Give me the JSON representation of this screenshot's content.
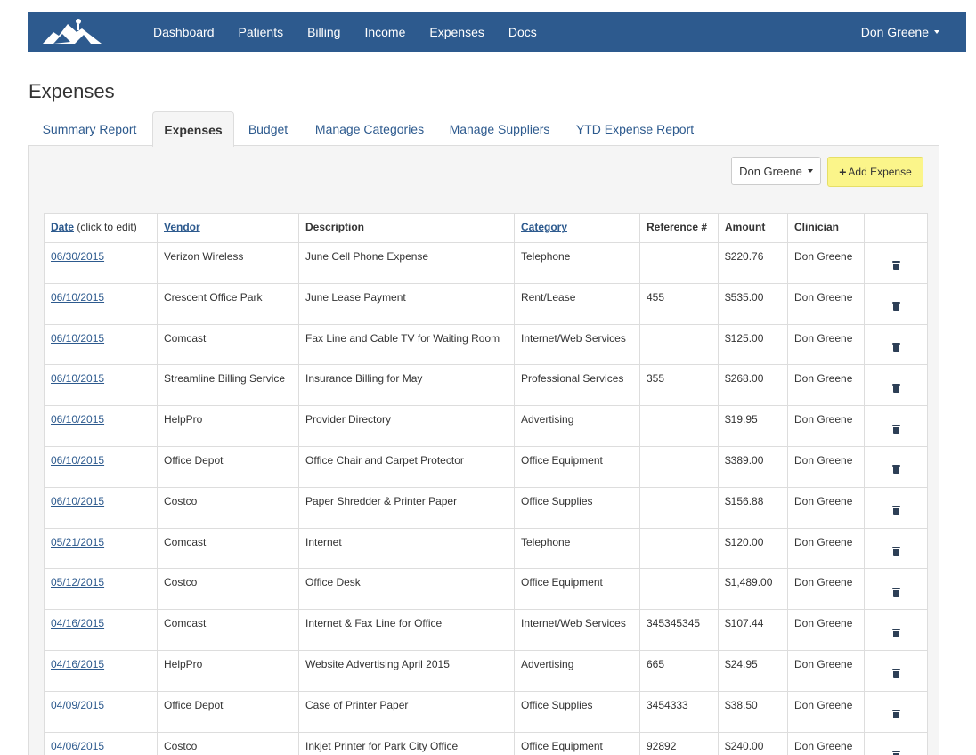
{
  "nav": {
    "links": [
      {
        "name": "nav-dashboard",
        "label": "Dashboard"
      },
      {
        "name": "nav-patients",
        "label": "Patients"
      },
      {
        "name": "nav-billing",
        "label": "Billing"
      },
      {
        "name": "nav-income",
        "label": "Income"
      },
      {
        "name": "nav-expenses",
        "label": "Expenses"
      },
      {
        "name": "nav-docs",
        "label": "Docs"
      }
    ],
    "user": "Don Greene",
    "logo_icon": "mountain-logo-icon"
  },
  "page": {
    "title": "Expenses"
  },
  "tabs": [
    {
      "name": "tab-summary-report",
      "label": "Summary Report",
      "active": false
    },
    {
      "name": "tab-expenses",
      "label": "Expenses",
      "active": true
    },
    {
      "name": "tab-budget",
      "label": "Budget",
      "active": false
    },
    {
      "name": "tab-manage-categories",
      "label": "Manage Categories",
      "active": false
    },
    {
      "name": "tab-manage-suppliers",
      "label": "Manage Suppliers",
      "active": false
    },
    {
      "name": "tab-ytd-expense-report",
      "label": "YTD Expense Report",
      "active": false
    }
  ],
  "toolbar": {
    "clinician_select": "Don Greene",
    "add_label": "Add Expense",
    "add_icon": "plus-icon"
  },
  "table": {
    "headers": {
      "date": "Date",
      "date_hint": "(click to edit)",
      "vendor": "Vendor",
      "description": "Description",
      "category": "Category",
      "reference": "Reference #",
      "amount": "Amount",
      "clinician": "Clinician"
    },
    "delete_icon": "trash-icon",
    "rows": [
      {
        "date": "06/30/2015",
        "vendor": "Verizon Wireless",
        "description": "June Cell Phone Expense",
        "category": "Telephone",
        "reference": "",
        "amount": "$220.76",
        "clinician": "Don Greene"
      },
      {
        "date": "06/10/2015",
        "vendor": "Crescent Office Park",
        "description": "June Lease Payment",
        "category": "Rent/Lease",
        "reference": "455",
        "amount": "$535.00",
        "clinician": "Don Greene"
      },
      {
        "date": "06/10/2015",
        "vendor": "Comcast",
        "description": "Fax Line and Cable TV for Waiting Room",
        "category": "Internet/Web Services",
        "reference": "",
        "amount": "$125.00",
        "clinician": "Don Greene"
      },
      {
        "date": "06/10/2015",
        "vendor": "Streamline Billing Service",
        "description": "Insurance Billing for May",
        "category": "Professional Services",
        "reference": "355",
        "amount": "$268.00",
        "clinician": "Don Greene"
      },
      {
        "date": "06/10/2015",
        "vendor": "HelpPro",
        "description": "Provider Directory",
        "category": "Advertising",
        "reference": "",
        "amount": "$19.95",
        "clinician": "Don Greene"
      },
      {
        "date": "06/10/2015",
        "vendor": "Office Depot",
        "description": "Office Chair and Carpet Protector",
        "category": "Office Equipment",
        "reference": "",
        "amount": "$389.00",
        "clinician": "Don Greene"
      },
      {
        "date": "06/10/2015",
        "vendor": "Costco",
        "description": "Paper Shredder & Printer Paper",
        "category": "Office Supplies",
        "reference": "",
        "amount": "$156.88",
        "clinician": "Don Greene"
      },
      {
        "date": "05/21/2015",
        "vendor": "Comcast",
        "description": "Internet",
        "category": "Telephone",
        "reference": "",
        "amount": "$120.00",
        "clinician": "Don Greene"
      },
      {
        "date": "05/12/2015",
        "vendor": "Costco",
        "description": "Office Desk",
        "category": "Office Equipment",
        "reference": "",
        "amount": "$1,489.00",
        "clinician": "Don Greene"
      },
      {
        "date": "04/16/2015",
        "vendor": "Comcast",
        "description": "Internet & Fax Line for Office",
        "category": "Internet/Web Services",
        "reference": "345345345",
        "amount": "$107.44",
        "clinician": "Don Greene"
      },
      {
        "date": "04/16/2015",
        "vendor": "HelpPro",
        "description": "Website Advertising April 2015",
        "category": "Advertising",
        "reference": "665",
        "amount": "$24.95",
        "clinician": "Don Greene"
      },
      {
        "date": "04/09/2015",
        "vendor": "Office Depot",
        "description": "Case of Printer Paper",
        "category": "Office Supplies",
        "reference": "3454333",
        "amount": "$38.50",
        "clinician": "Don Greene"
      },
      {
        "date": "04/06/2015",
        "vendor": "Costco",
        "description": "Inkjet Printer for Park City Office",
        "category": "Office Equipment",
        "reference": "92892",
        "amount": "$240.00",
        "clinician": "Don Greene"
      }
    ]
  },
  "colors": {
    "navbar": "#2d5a8e",
    "link": "#2d5a8e",
    "add_button": "#fbf58a"
  }
}
